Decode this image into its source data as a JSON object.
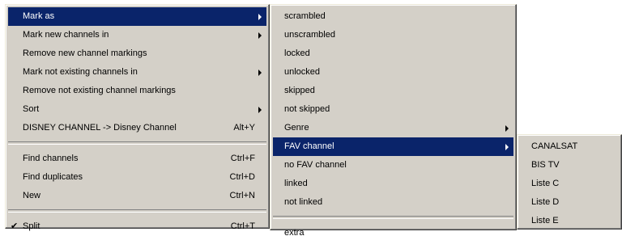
{
  "main_menu": {
    "mark_as": "Mark as",
    "mark_new_channels_in": "Mark new channels in",
    "remove_new_channel_markings": "Remove new channel markings",
    "mark_not_existing_channels_in": "Mark not existing channels in",
    "remove_not_existing_channel_markings": "Remove not existing channel markings",
    "sort": "Sort",
    "disney_rename": "DISNEY CHANNEL -> Disney Channel",
    "disney_rename_shortcut": "Alt+Y",
    "find_channels": "Find channels",
    "find_channels_shortcut": "Ctrl+F",
    "find_duplicates": "Find duplicates",
    "find_duplicates_shortcut": "Ctrl+D",
    "new": "New",
    "new_shortcut": "Ctrl+N",
    "split": "Split",
    "split_shortcut": "Ctrl+T",
    "check_glyph": "✔"
  },
  "mark_as_submenu": {
    "scrambled": "scrambled",
    "unscrambled": "unscrambled",
    "locked": "locked",
    "unlocked": "unlocked",
    "skipped": "skipped",
    "not_skipped": "not skipped",
    "genre": "Genre",
    "fav_channel": "FAV channel",
    "no_fav_channel": "no FAV channel",
    "linked": "linked",
    "not_linked": "not linked",
    "extra": "extra"
  },
  "fav_submenu": {
    "items": [
      "CANALSAT",
      "BIS TV",
      "Liste C",
      "Liste D",
      "Liste E"
    ]
  },
  "colors": {
    "menu_background": "#d4d0c8",
    "highlight": "#0a246a",
    "highlight_text": "#ffffff"
  }
}
